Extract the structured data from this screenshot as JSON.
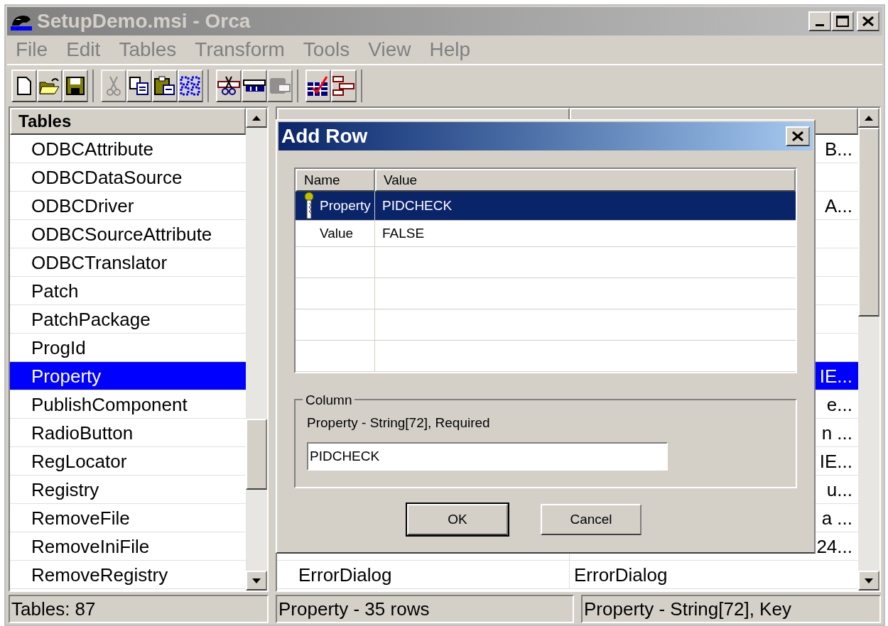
{
  "window": {
    "title": "SetupDemo.msi - Orca",
    "active": false
  },
  "menu": [
    "File",
    "Edit",
    "Tables",
    "Transform",
    "Tools",
    "View",
    "Help"
  ],
  "toolbar": [
    [
      {
        "kind": "new",
        "disabled": false
      },
      {
        "kind": "open",
        "disabled": false
      },
      {
        "kind": "save",
        "disabled": false
      }
    ],
    [
      {
        "kind": "cut",
        "disabled": true
      },
      {
        "kind": "copy",
        "disabled": false
      },
      {
        "kind": "paste",
        "disabled": false
      },
      {
        "kind": "grid",
        "disabled": false
      }
    ],
    [
      {
        "kind": "cut-row",
        "disabled": false
      },
      {
        "kind": "row",
        "disabled": false
      },
      {
        "kind": "paste-row",
        "disabled": true
      }
    ],
    [
      {
        "kind": "validate",
        "disabled": false
      },
      {
        "kind": "tables",
        "disabled": false
      }
    ]
  ],
  "tables": {
    "header": "Tables",
    "items": [
      {
        "label": "ODBCAttribute",
        "selected": false
      },
      {
        "label": "ODBCDataSource",
        "selected": false
      },
      {
        "label": "ODBCDriver",
        "selected": false
      },
      {
        "label": "ODBCSourceAttribute",
        "selected": false
      },
      {
        "label": "ODBCTranslator",
        "selected": false
      },
      {
        "label": "Patch",
        "selected": false
      },
      {
        "label": "PatchPackage",
        "selected": false
      },
      {
        "label": "ProgId",
        "selected": false
      },
      {
        "label": "Property",
        "selected": true
      },
      {
        "label": "PublishComponent",
        "selected": false
      },
      {
        "label": "RadioButton",
        "selected": false
      },
      {
        "label": "RegLocator",
        "selected": false
      },
      {
        "label": "Registry",
        "selected": false
      },
      {
        "label": "RemoveFile",
        "selected": false
      },
      {
        "label": "RemoveIniFile",
        "selected": false
      },
      {
        "label": "RemoveRegistry",
        "selected": false
      }
    ]
  },
  "rows": [
    {
      "selected": false,
      "column_2": "B..."
    },
    {
      "selected": false
    },
    {
      "selected": false,
      "column_2": "A..."
    },
    {
      "selected": false
    },
    {
      "selected": false
    },
    {
      "selected": false
    },
    {
      "selected": false
    },
    {
      "selected": false
    },
    {
      "selected": true,
      "column_2": "IE..."
    },
    {
      "selected": false,
      "column_2": "e..."
    },
    {
      "selected": false,
      "column_2": "n ..."
    },
    {
      "selected": false,
      "column_2": "IE..."
    },
    {
      "selected": false,
      "column_2": "u..."
    },
    {
      "selected": false,
      "column_2": "a ..."
    },
    {
      "selected": false,
      "column_2": "24..."
    },
    {
      "selected": false,
      "column_1": "ErrorDialog",
      "column_2": "ErrorDialog"
    }
  ],
  "status_bar": [
    "Tables: 87",
    "Property - 35 rows",
    "Property - String[72], Key"
  ],
  "dialog": {
    "title": "Add Row",
    "columns": [
      "Name",
      "Value"
    ],
    "rows": [
      {
        "name": "Property",
        "value": "PIDCHECK",
        "key": true,
        "selected": true
      },
      {
        "name": "Value",
        "value": "FALSE",
        "key": false,
        "selected": false
      }
    ],
    "group": {
      "label": "Column",
      "description": "Property - String[72], Required",
      "value": "PIDCHECK"
    },
    "buttons": [
      {
        "label": "OK",
        "default": true
      },
      {
        "label": "Cancel",
        "default": false
      }
    ]
  }
}
